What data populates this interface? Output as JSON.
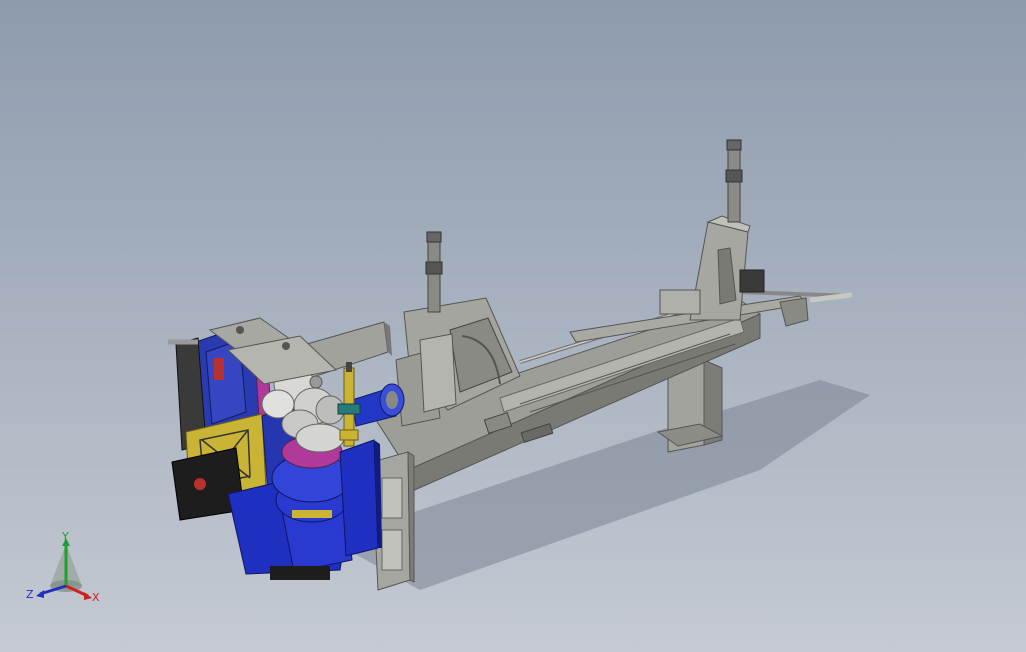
{
  "viewport": {
    "background_top": "#8e9bad",
    "background_bottom": "#c5cad3"
  },
  "model": {
    "colors": {
      "frame": "#9a9a96",
      "frame_dark": "#6f6f6b",
      "frame_light": "#c4c4bf",
      "head_blue": "#2a3bb0",
      "head_blue_dark": "#1a2470",
      "motor_blue": "#1f2fbf",
      "yellow_plate": "#c9b436",
      "magenta": "#b03a9a",
      "black": "#1d1d1d",
      "red": "#b83030"
    }
  },
  "triad": {
    "x_label": "X",
    "y_label": "Y",
    "z_label": "Z",
    "x_color": "#d02020",
    "y_color": "#20a030",
    "z_color": "#2030c0"
  }
}
